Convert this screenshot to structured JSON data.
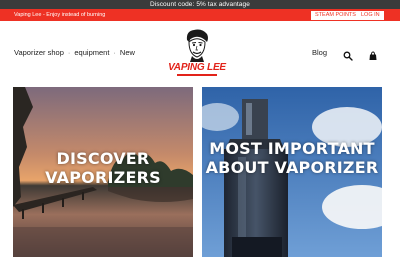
{
  "announcement": "Discount code: 5% tax advantage",
  "topbar": {
    "tagline": "Vaping Lee - Enjoy instead of burning",
    "steam_points": "STEAM POINTS",
    "login": "LOG IN"
  },
  "nav": {
    "items": [
      "Vaporizer shop",
      "equipment",
      "New"
    ],
    "blog": "Blog"
  },
  "brand": {
    "name": "VAPING LEE"
  },
  "tiles": [
    {
      "title": "DISCOVER VAPORIZERS"
    },
    {
      "title": "MOST IMPORTANT ABOUT VAPORIZER"
    }
  ],
  "colors": {
    "brand_red": "#ee3124",
    "banner_dark": "#3b3b3b"
  },
  "icons": {
    "search": "search-icon",
    "cart": "cart-icon"
  }
}
